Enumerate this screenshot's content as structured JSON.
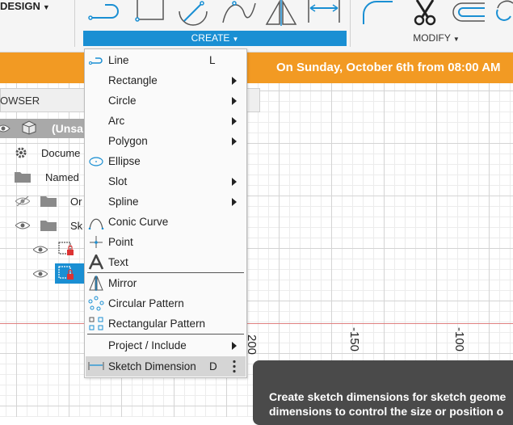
{
  "toolbar": {
    "design_label": "DESIGN",
    "create_label": "CREATE",
    "modify_label": "MODIFY",
    "accent": "#1a8fd3"
  },
  "banner": {
    "text": "On Sunday, October 6th from 08:00 AM",
    "color": "#f29a23"
  },
  "browser": {
    "title": "OWSER",
    "root_label": "(Unsa",
    "rows": [
      {
        "label": "Docume"
      },
      {
        "label": "Named"
      },
      {
        "label": "Or"
      },
      {
        "label": "Sk"
      }
    ]
  },
  "canvas": {
    "axis_labels": [
      "200",
      "-150",
      "-100"
    ]
  },
  "menu": {
    "items": [
      {
        "label": "Line",
        "shortcut": "L",
        "icon": "line-icon"
      },
      {
        "label": "Rectangle",
        "submenu": true
      },
      {
        "label": "Circle",
        "submenu": true
      },
      {
        "label": "Arc",
        "submenu": true
      },
      {
        "label": "Polygon",
        "submenu": true
      },
      {
        "label": "Ellipse",
        "icon": "ellipse-icon"
      },
      {
        "label": "Slot",
        "submenu": true
      },
      {
        "label": "Spline",
        "submenu": true
      },
      {
        "label": "Conic Curve",
        "icon": "conic-curve-icon"
      },
      {
        "label": "Point",
        "icon": "point-icon"
      },
      {
        "label": "Text",
        "icon": "text-icon"
      },
      {
        "label": "Mirror",
        "icon": "mirror-icon"
      },
      {
        "label": "Circular Pattern",
        "icon": "circular-pattern-icon"
      },
      {
        "label": "Rectangular Pattern",
        "icon": "rectangular-pattern-icon"
      },
      {
        "label": "Project / Include",
        "submenu": true
      },
      {
        "label": "Sketch Dimension",
        "shortcut": "D",
        "icon": "sketch-dimension-icon",
        "highlighted": true
      }
    ]
  },
  "tooltip": {
    "line1": "Create sketch dimensions for sketch geome",
    "line2": "dimensions to control the size or position o"
  }
}
